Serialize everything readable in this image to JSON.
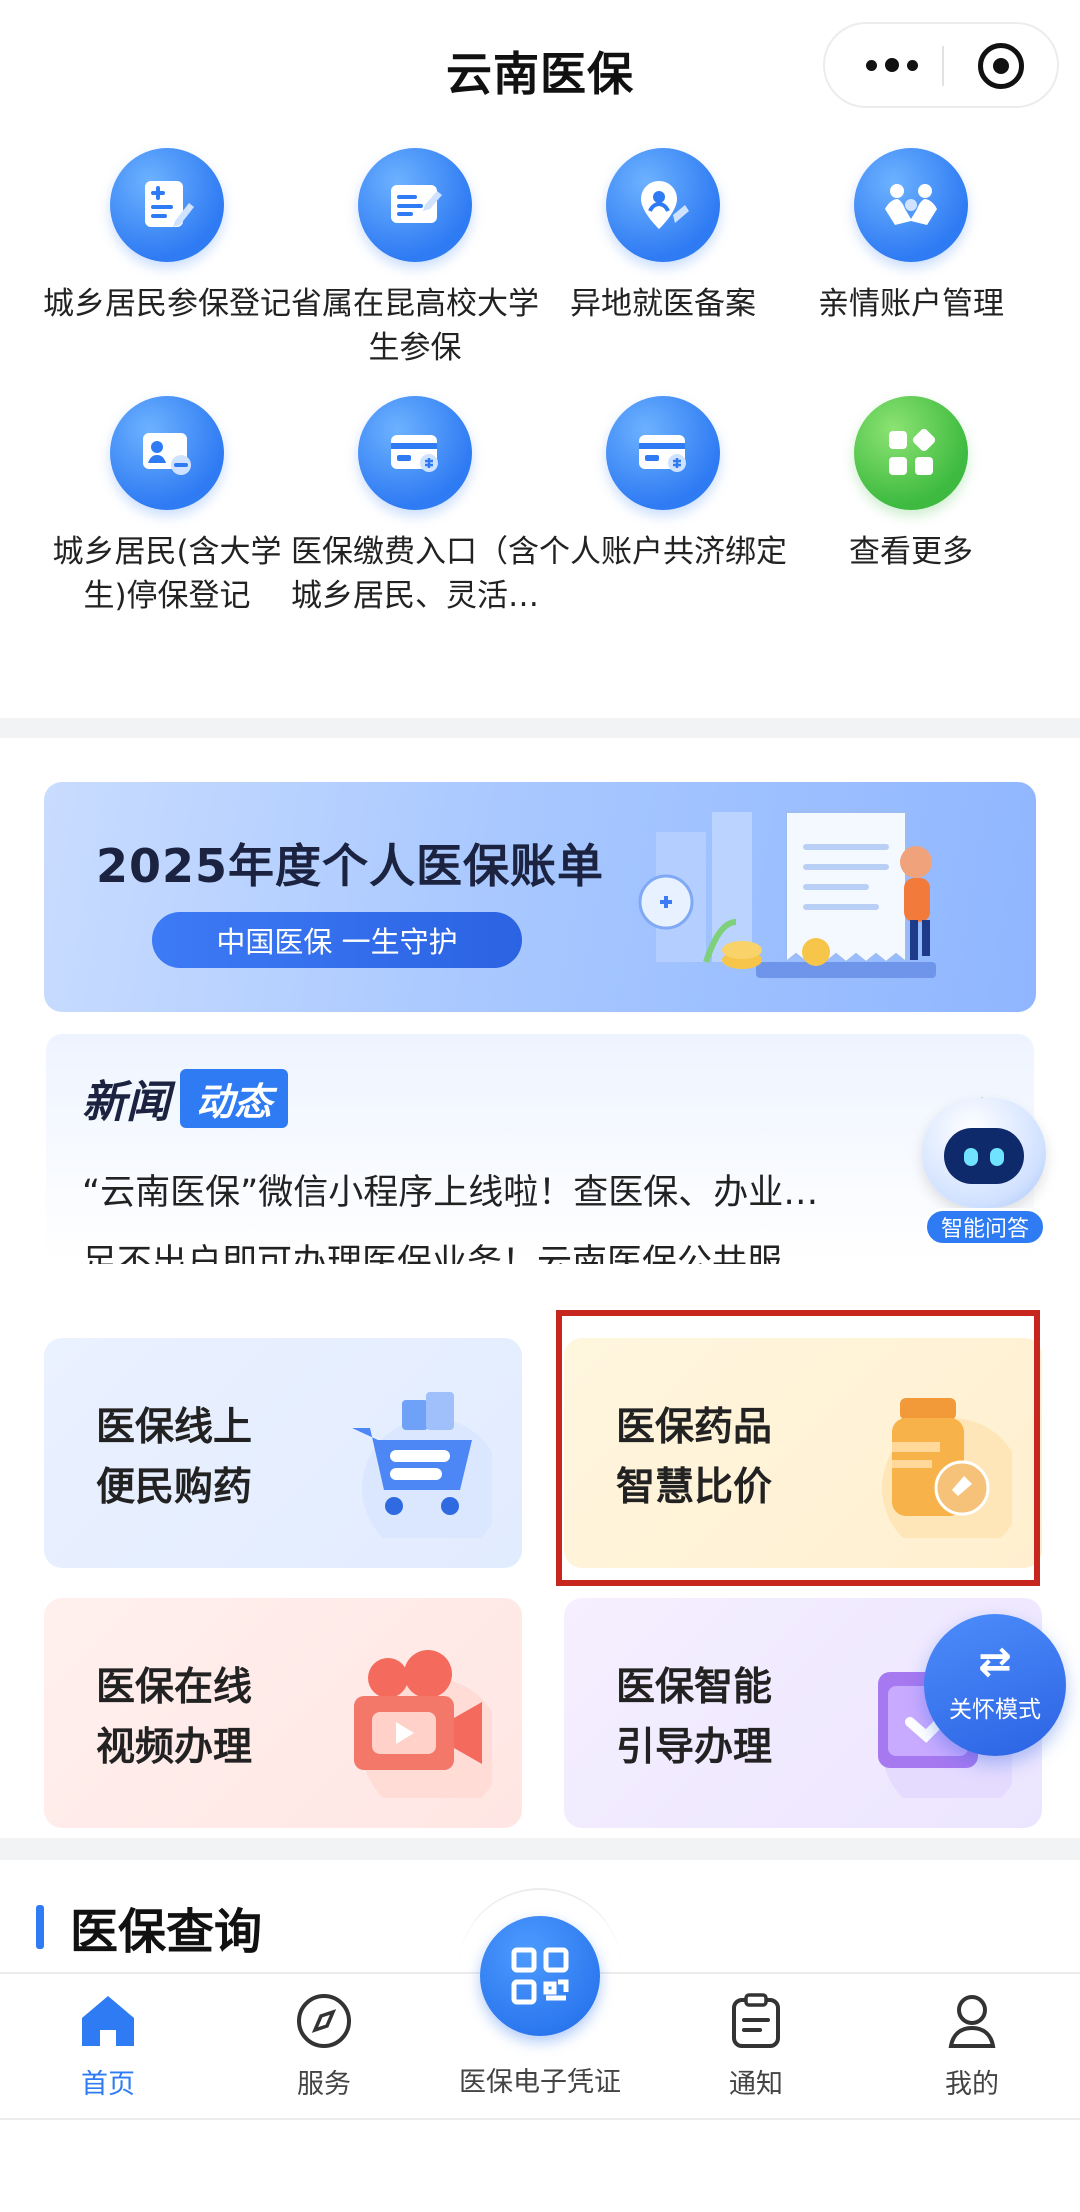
{
  "header": {
    "title": "云南医保"
  },
  "services": [
    {
      "label": "城乡居民参保登记",
      "icon": "register-form-icon"
    },
    {
      "label": "省属在昆高校大学生参保",
      "icon": "student-card-icon"
    },
    {
      "label": "异地就医备案",
      "icon": "location-pin-icon"
    },
    {
      "label": "亲情账户管理",
      "icon": "family-icon"
    },
    {
      "label": "城乡居民(含大学生)停保登记",
      "icon": "id-card-minus-icon"
    },
    {
      "label": "医保缴费入口（含城乡居民、灵活…",
      "icon": "payment-card-icon"
    },
    {
      "label": "个人账户共济绑定",
      "icon": "shared-account-card-icon"
    },
    {
      "label": "查看更多",
      "icon": "more-grid-icon"
    }
  ],
  "banner": {
    "title": "2025年度个人医保账单",
    "pill": "中国医保  一生守护"
  },
  "news": {
    "title_a": "新闻",
    "title_b": "动态",
    "line1": "“云南医保”微信小程序上线啦！查医保、办业…",
    "line2": "足不出户即可办理医保业务！云南医保公共服"
  },
  "assistant": {
    "label": "智能问答"
  },
  "cards": [
    {
      "line1": "医保线上",
      "line2": "便民购药"
    },
    {
      "line1": "医保药品",
      "line2": "智慧比价"
    },
    {
      "line1": "医保在线",
      "line2": "视频办理"
    },
    {
      "line1": "医保智能",
      "line2": "引导办理"
    }
  ],
  "care_mode": {
    "label": "关怀模式"
  },
  "section": {
    "title": "医保查询"
  },
  "tabbar": {
    "home": "首页",
    "service": "服务",
    "center": "医保电子凭证",
    "notice": "通知",
    "mine": "我的"
  },
  "colors": {
    "primary": "#2f7bf3",
    "highlight_border": "#c6261d"
  }
}
